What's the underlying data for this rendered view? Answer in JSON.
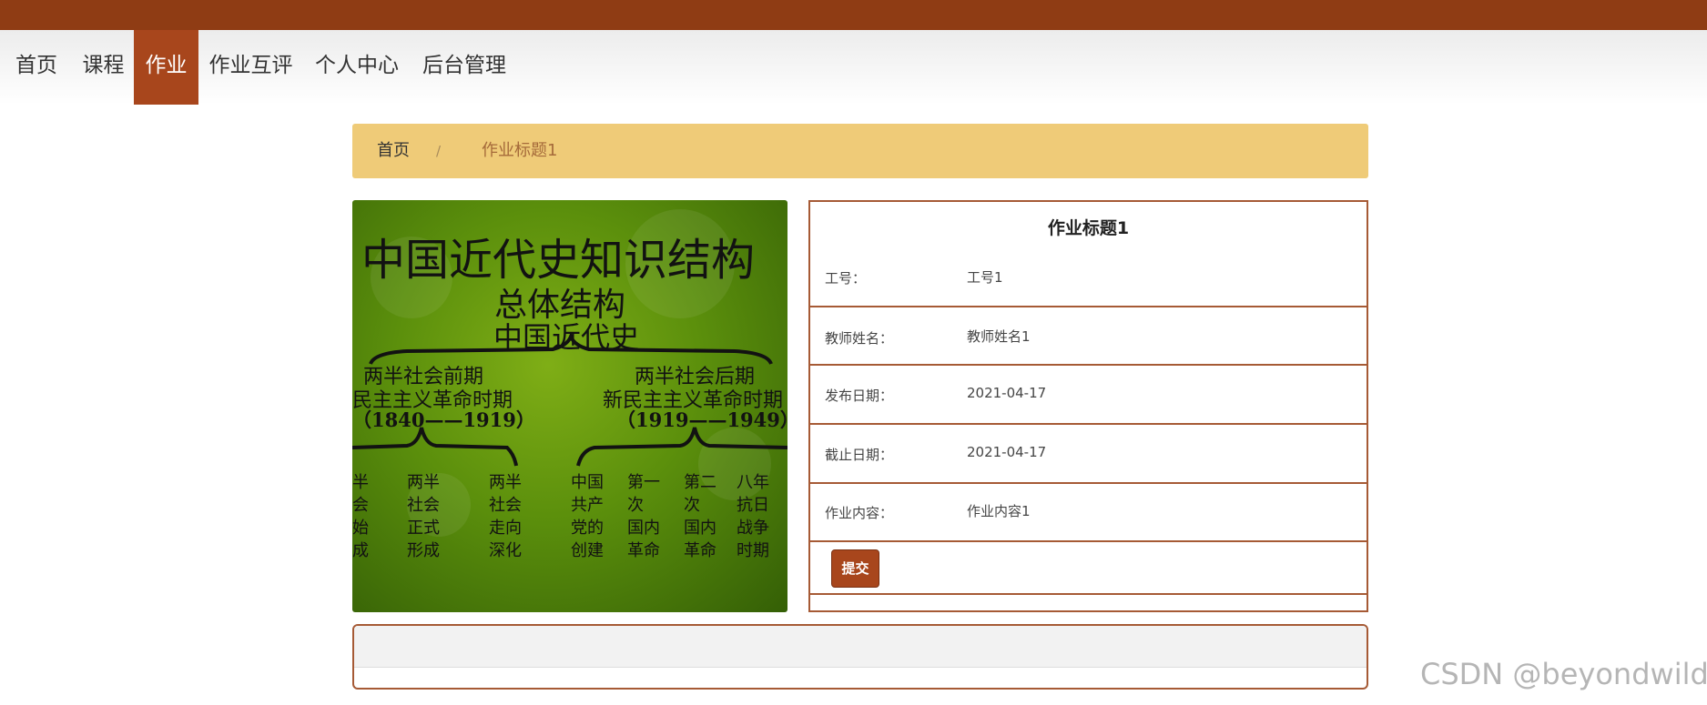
{
  "nav": {
    "items": [
      {
        "label": "首页"
      },
      {
        "label": "课程"
      },
      {
        "label": "作业",
        "active": true
      },
      {
        "label": "作业互评"
      },
      {
        "label": "个人中心"
      },
      {
        "label": "后台管理"
      }
    ]
  },
  "breadcrumb": {
    "home": "首页",
    "separator": "/",
    "current": "作业标题1"
  },
  "image": {
    "title": "中国近代史知识结构",
    "subtitle": "总体结构",
    "subtitle2": "中国近代史",
    "left_period": "两半社会前期",
    "left_era": "民主主义革命时期",
    "left_years": "（1840——1919）",
    "right_period": "两半社会后期",
    "right_era": "新民主主义革命时期",
    "right_years": "（1919——1949）",
    "columns": [
      [
        "半",
        "会",
        "始",
        "成"
      ],
      [
        "两半",
        "社会",
        "正式",
        "形成"
      ],
      [
        "两半",
        "社会",
        "走向",
        "深化"
      ],
      [
        "中国",
        "共产",
        "党的",
        "创建"
      ],
      [
        "第一",
        "次",
        "国内",
        "革命"
      ],
      [
        "第二",
        "次",
        "国内",
        "革命"
      ],
      [
        "八年",
        "抗日",
        "战争",
        "时期"
      ]
    ]
  },
  "detail": {
    "title": "作业标题1",
    "rows": [
      {
        "label": "工号：",
        "value": "工号1"
      },
      {
        "label": "教师姓名：",
        "value": "教师姓名1"
      },
      {
        "label": "发布日期：",
        "value": "2021-04-17"
      },
      {
        "label": "截止日期：",
        "value": "2021-04-17"
      },
      {
        "label": "作业内容：",
        "value": "作业内容1"
      }
    ],
    "submit_label": "提交"
  },
  "watermark": "CSDN @beyondwild",
  "colors": {
    "topbar": "#8f3c14",
    "accent": "#a8461c",
    "breadcrumb_bg": "#efcb78",
    "panel_border": "#a65a35"
  }
}
